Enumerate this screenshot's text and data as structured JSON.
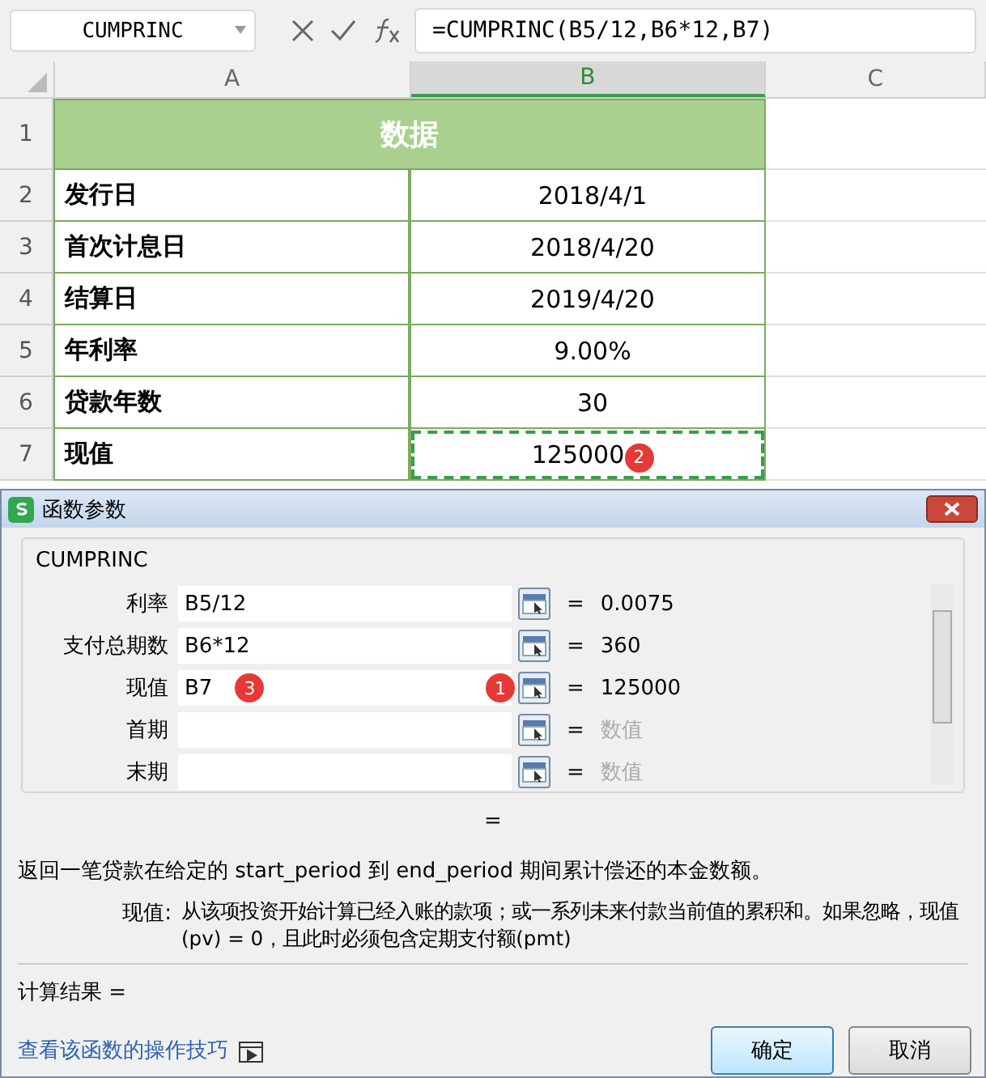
{
  "name_box": "CUMPRINC",
  "formula": "=CUMPRINC(B5/12,B6*12,B7)",
  "columns": [
    {
      "label": "A",
      "selected": false
    },
    {
      "label": "B",
      "selected": true
    },
    {
      "label": "C",
      "selected": false
    }
  ],
  "rows": [
    {
      "number": "1",
      "kind": "header",
      "cells": [
        "数据"
      ]
    },
    {
      "number": "2",
      "kind": "data",
      "cells": [
        "发行日",
        "2018/4/1"
      ]
    },
    {
      "number": "3",
      "kind": "data",
      "cells": [
        "首次计息日",
        "2018/4/20"
      ]
    },
    {
      "number": "4",
      "kind": "data",
      "cells": [
        "结算日",
        "2019/4/20"
      ]
    },
    {
      "number": "5",
      "kind": "data",
      "cells": [
        "年利率",
        "9.00%"
      ]
    },
    {
      "number": "6",
      "kind": "data",
      "cells": [
        "贷款年数",
        "30"
      ]
    },
    {
      "number": "7",
      "kind": "data",
      "cells": [
        "现值",
        "125000"
      ],
      "marquee": true,
      "badge": "2"
    }
  ],
  "dialog": {
    "title": "函数参数",
    "function": "CUMPRINC",
    "args": [
      {
        "label": "利率",
        "value": "B5/12",
        "equals": "=",
        "result": "0.0075",
        "resolved": true
      },
      {
        "label": "支付总期数",
        "value": "B6*12",
        "equals": "=",
        "result": "360",
        "resolved": true
      },
      {
        "label": "现值",
        "value": "B7",
        "equals": "=",
        "result": "125000",
        "resolved": true,
        "badge": "3",
        "button_badge": "1"
      },
      {
        "label": "首期",
        "equals": "=",
        "result": "数值",
        "resolved": false
      },
      {
        "label": "末期",
        "equals": "=",
        "result": "数值",
        "resolved": false
      }
    ],
    "total": "=",
    "description": "返回一笔贷款在给定的 start_period 到 end_period 期间累计偿还的本金数额。",
    "param_label": "现值:",
    "param_text": "从该项投资开始计算已经入账的款项；或一系列未来付款当前值的累积和。如果忽略，现值(pv) = 0，且此时必须包含定期支付额(pmt)",
    "result_label": "计算结果 =",
    "help_link": "查看该函数的操作技巧",
    "buttons": [
      {
        "label": "确定",
        "default": true
      },
      {
        "label": "取消",
        "default": false
      }
    ]
  }
}
